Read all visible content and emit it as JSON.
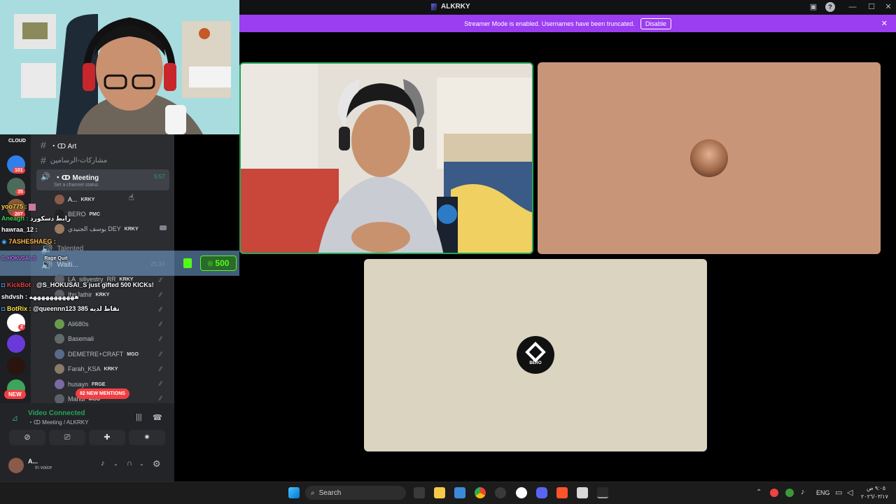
{
  "window": {
    "title": "ALKRKY"
  },
  "banner": {
    "text": "Streamer Mode is enabled. Usernames have been truncated.",
    "disable_label": "Disable",
    "color": "#9b3df0"
  },
  "channels": {
    "art": "・ↀ Art",
    "art_sub": "مشاركات-الرسامين",
    "meeting": "・ↀ Meeting",
    "meeting_time": "5:57",
    "meeting_status": "Set a channel status",
    "talented": "Talented",
    "waiting": "Waiti...",
    "waiting_time": "25:33"
  },
  "members": [
    {
      "name": "A...",
      "tag": "KRKY"
    },
    {
      "name": "BERO",
      "tag": "PMC"
    },
    {
      "name": "يوسف الجنيدي DEY",
      "tag": "KRKY"
    },
    {
      "name": "LA_siliyestry_RR",
      "tag": "KRKY"
    },
    {
      "name": "IbnJathir",
      "tag": "KRKY"
    },
    {
      "name": "Ali680s",
      "tag": ""
    },
    {
      "name": "Basemali",
      "tag": ""
    },
    {
      "name": "DEMETRE+CRAFT",
      "tag": "MGO"
    },
    {
      "name": "Farah_KSA",
      "tag": "KRKY"
    },
    {
      "name": "husayn",
      "tag": "FRGE"
    },
    {
      "name": "Mahdi",
      "tag": "MGO"
    }
  ],
  "guild_badges": {
    "b1": "101",
    "b2": "35",
    "b3": "207",
    "b4": "2"
  },
  "new_label": "NEW",
  "mentions_label": "82 NEW MENTIONS",
  "chat": [
    {
      "user": "yoo775 :",
      "text": "",
      "color": "#ffd84a"
    },
    {
      "user": "Aneagh :",
      "text": "رابط دسكورد",
      "color": "#39d353"
    },
    {
      "user": "hawraa_12 :",
      "text": "",
      "color": "#ffffff"
    },
    {
      "user": "7ASHESHAEG :",
      "text": "",
      "color": "#ffb84a"
    },
    {
      "user": "S_HOKUSAI_S",
      "text": "Rage Quit",
      "color": "#c86bff"
    },
    {
      "user": "KickBot :",
      "text": "@S_HOKUSAI_S just gifted 500 KICKs!",
      "color": "#e84040"
    },
    {
      "user": "shdvsh :",
      "text": "هههههههههههه",
      "color": "#ffffff"
    },
    {
      "user": "BotRix :",
      "text": "@queennn123 385 نقاط لديه",
      "color": "#ffe14a"
    }
  ],
  "kicks_amount": "500",
  "voice": {
    "status": "Video Connected",
    "channel": "・ↀ Meeting / ALKRKY",
    "user_name": "A...",
    "user_status": "In voice"
  },
  "taskbar": {
    "search_placeholder": "Search",
    "language": "ENG",
    "time": "٩:٠٥ ص",
    "date": "٢٠٢٦/٠٣/١٧"
  },
  "tile_labels": {
    "bero": "BERO"
  },
  "colors": {
    "accent_green": "#23a55a",
    "discord_bg": "#2b2d31",
    "tile_rust": "#c99578",
    "tile_beige": "#dad4c0"
  }
}
